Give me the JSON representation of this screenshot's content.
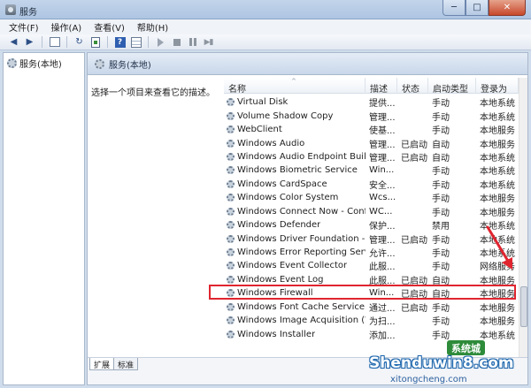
{
  "window": {
    "title": "服务",
    "minimize_glyph": "─",
    "maximize_glyph": "□",
    "close_glyph": "✕"
  },
  "menu": [
    "文件(F)",
    "操作(A)",
    "查看(V)",
    "帮助(H)"
  ],
  "toolbar": {
    "back_glyph": "◀",
    "forward_glyph": "▶",
    "refresh_glyph": "↻",
    "export_glyph": "➔",
    "help_glyph": "?",
    "restart_glyph": "▶▮"
  },
  "tree": {
    "root_label": "服务(本地)"
  },
  "pane": {
    "header_title": "服务(本地)",
    "description_text": "选择一个项目来查看它的描述。"
  },
  "list": {
    "columns": [
      "名称",
      "描述",
      "状态",
      "启动类型",
      "登录为"
    ],
    "sort_caret": "^",
    "rows": [
      {
        "name": "Virtual Disk",
        "desc": "提供...",
        "status": "",
        "startup": "手动",
        "logon": "本地系统"
      },
      {
        "name": "Volume Shadow Copy",
        "desc": "管理...",
        "status": "",
        "startup": "手动",
        "logon": "本地系统"
      },
      {
        "name": "WebClient",
        "desc": "使基...",
        "status": "",
        "startup": "手动",
        "logon": "本地服务"
      },
      {
        "name": "Windows Audio",
        "desc": "管理...",
        "status": "已启动",
        "startup": "自动",
        "logon": "本地服务"
      },
      {
        "name": "Windows Audio Endpoint Builder",
        "desc": "管理...",
        "status": "已启动",
        "startup": "自动",
        "logon": "本地系统"
      },
      {
        "name": "Windows Biometric Service",
        "desc": "Win...",
        "status": "",
        "startup": "手动",
        "logon": "本地系统"
      },
      {
        "name": "Windows CardSpace",
        "desc": "安全...",
        "status": "",
        "startup": "手动",
        "logon": "本地系统"
      },
      {
        "name": "Windows Color System",
        "desc": "Wcs...",
        "status": "",
        "startup": "手动",
        "logon": "本地服务"
      },
      {
        "name": "Windows Connect Now - Confi...",
        "desc": "WC...",
        "status": "",
        "startup": "手动",
        "logon": "本地服务"
      },
      {
        "name": "Windows Defender",
        "desc": "保护...",
        "status": "",
        "startup": "禁用",
        "logon": "本地系统"
      },
      {
        "name": "Windows Driver Foundation - U...",
        "desc": "管理...",
        "status": "已启动",
        "startup": "手动",
        "logon": "本地系统"
      },
      {
        "name": "Windows Error Reporting Service",
        "desc": "允许...",
        "status": "",
        "startup": "手动",
        "logon": "本地系统"
      },
      {
        "name": "Windows Event Collector",
        "desc": "此服...",
        "status": "",
        "startup": "手动",
        "logon": "网络服务"
      },
      {
        "name": "Windows Event Log",
        "desc": "此服...",
        "status": "已启动",
        "startup": "自动",
        "logon": "本地服务"
      },
      {
        "name": "Windows Firewall",
        "desc": "Win...",
        "status": "已启动",
        "startup": "自动",
        "logon": "本地服务"
      },
      {
        "name": "Windows Font Cache Service",
        "desc": "通过...",
        "status": "已启动",
        "startup": "手动",
        "logon": "本地服务"
      },
      {
        "name": "Windows Image Acquisition (WI...",
        "desc": "为扫...",
        "status": "",
        "startup": "手动",
        "logon": "本地服务"
      },
      {
        "name": "Windows Installer",
        "desc": "添加...",
        "status": "",
        "startup": "手动",
        "logon": "本地系统"
      }
    ]
  },
  "tabs": [
    "扩展",
    "标准"
  ],
  "watermark": {
    "badge": "系统城",
    "main": "Shenduwin8.com",
    "sub": "xitongcheng.com"
  },
  "colors": {
    "highlight_border": "#e0252f",
    "annotation_arrow": "#e0252f"
  }
}
